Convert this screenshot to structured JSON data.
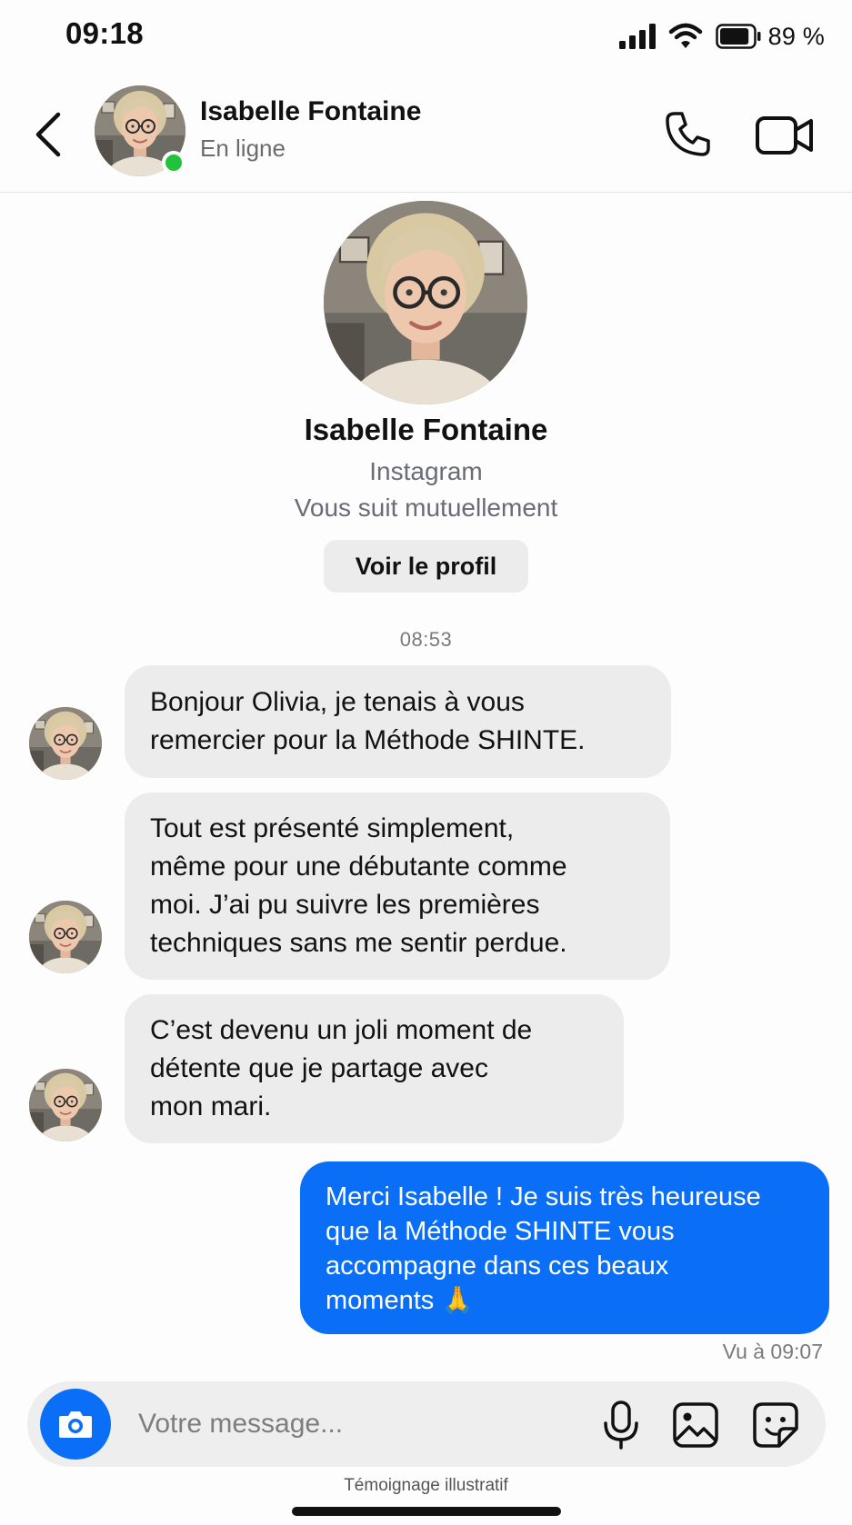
{
  "status_bar": {
    "time": "09:18",
    "battery_percent": "89 %",
    "battery_level": 0.89
  },
  "header": {
    "contact_name": "Isabelle Fontaine",
    "presence": "En ligne",
    "online": true
  },
  "profile": {
    "name": "Isabelle Fontaine",
    "platform": "Instagram",
    "relationship": "Vous suit mutuellement",
    "view_profile_label": "Voir le profil"
  },
  "thread": {
    "timestamp": "08:53",
    "incoming": [
      {
        "lines": [
          "Bonjour Olivia, je tenais à vous",
          "remercier pour la Méthode SHINTE."
        ]
      },
      {
        "lines": [
          "Tout est présenté simplement,",
          "même pour une débutante comme",
          "moi. J’ai pu suivre les premières",
          "techniques sans me sentir perdue."
        ]
      },
      {
        "lines": [
          "C’est devenu un joli moment de",
          "détente que je partage avec",
          "mon mari."
        ]
      }
    ],
    "outgoing": {
      "lines": [
        "Merci Isabelle ! Je suis très heureuse",
        "que la Méthode SHINTE vous",
        "accompagne dans ces beaux",
        "moments 🙏"
      ]
    },
    "seen_receipt": "Vu à 09:07"
  },
  "composer": {
    "placeholder": "Votre message..."
  },
  "footer": {
    "disclaimer": "Témoignage illustratif"
  },
  "colors": {
    "accent": "#0a6ef7",
    "online": "#22c33a",
    "incoming_bubble": "#ececed"
  },
  "icons": [
    "back-chevron-icon",
    "phone-icon",
    "video-camera-icon",
    "camera-icon",
    "microphone-icon",
    "gallery-icon",
    "sticker-icon",
    "signal-icon",
    "wifi-icon",
    "battery-icon"
  ]
}
